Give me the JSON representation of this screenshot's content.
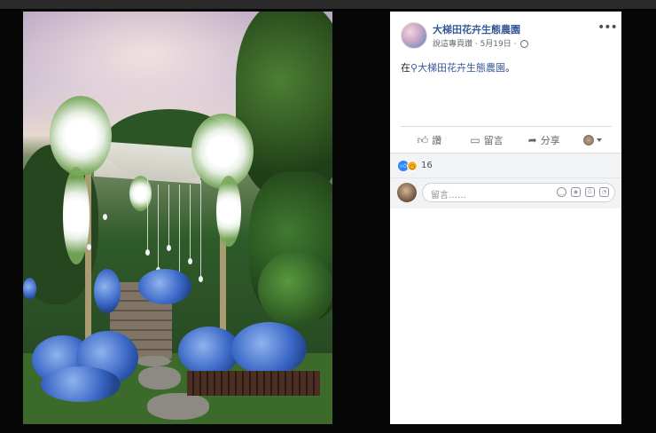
{
  "post": {
    "page_name": "大梯田花卉生態農園",
    "meta_text": "說這專頁讚 · 5月19日 ·",
    "location_prefix": "在",
    "location_name": "大梯田花卉生態農園",
    "location_suffix": "。",
    "more_label": "•••"
  },
  "actions": {
    "like_label": "讚",
    "comment_label": "留言",
    "share_label": "分享"
  },
  "reactions": {
    "count": "16",
    "like_icon": "thumbs-up-icon",
    "wow_icon": "wow-face-icon"
  },
  "comment": {
    "placeholder": "留言……",
    "icons": [
      "emoji-icon",
      "camera-icon",
      "gif-icon",
      "sticker-icon"
    ]
  },
  "photo": {
    "description_icon": "photo"
  },
  "colors": {
    "link": "#365899",
    "accent": "#2d88ff"
  }
}
